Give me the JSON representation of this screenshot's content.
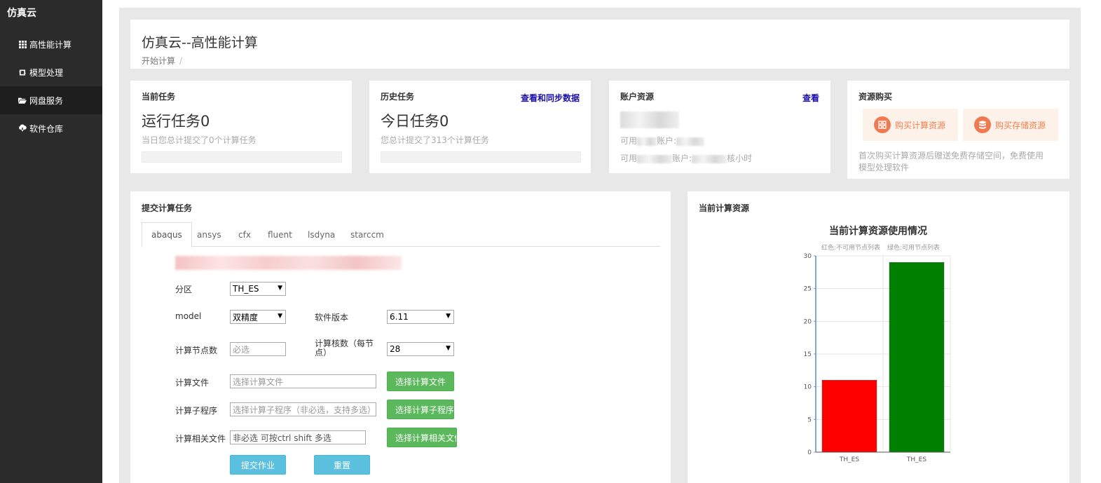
{
  "sidebar": {
    "brand": "仿真云",
    "items": [
      {
        "label": "高性能计算",
        "icon": "grid-icon"
      },
      {
        "label": "模型处理",
        "icon": "retweet-icon"
      },
      {
        "label": "网盘服务",
        "icon": "folder-open-icon"
      },
      {
        "label": "软件仓库",
        "icon": "cloud-download-icon"
      }
    ]
  },
  "header": {
    "title": "仿真云--高性能计算",
    "breadcrumb": "开始计算",
    "breadcrumb_sep": "/"
  },
  "cards": {
    "current": {
      "title": "当前任务",
      "big": "运行任务0",
      "sub": "当日您总计提交了0个计算任务"
    },
    "history": {
      "title": "历史任务",
      "link": "查看和同步数据",
      "big": "今日任务0",
      "sub": "您总计提交了313个计算任务"
    },
    "account": {
      "title": "账户资源",
      "link": "查看",
      "line1_a": "可用",
      "line1_b": "账户:",
      "line2_a": "可用",
      "line2_b": "账户:",
      "line2_c": "核小时"
    },
    "purchase": {
      "title": "资源购买",
      "buy_compute": "购买计算资源",
      "buy_storage": "购买存储资源",
      "note": "首次购买计算资源后赠送免费存储空间，免费使用模型处理软件"
    }
  },
  "submit": {
    "title": "提交计算任务",
    "tabs": [
      "abaqus",
      "ansys",
      "cfx",
      "fluent",
      "lsdyna",
      "starccm"
    ],
    "active_tab": "abaqus",
    "fields": {
      "partition_label": "分区",
      "partition_value": "TH_ES",
      "model_label": "model",
      "model_value": "双精度",
      "version_label": "软件版本",
      "version_value": "6.11",
      "nodes_label": "计算节点数",
      "nodes_placeholder": "必选",
      "cores_label": "计算核数（每节点）",
      "cores_value": "28",
      "file_label": "计算文件",
      "file_placeholder": "选择计算文件",
      "file_button": "选择计算文件",
      "subprog_label": "计算子程序",
      "subprog_placeholder": "选择计算子程序（非必选，支持多选）",
      "subprog_button": "选择计算子程序",
      "related_label": "计算相关文件",
      "related_placeholder": "非必选 可按ctrl shift 多选",
      "related_button": "选择计算相关文件"
    },
    "submit_button": "提交作业",
    "reset_button": "重置"
  },
  "resources": {
    "title": "当前计算资源",
    "colors": {
      "unavailable": "#ff0000",
      "available": "#008000"
    }
  },
  "chart_data": {
    "type": "bar",
    "title": "当前计算资源使用情况",
    "legend": [
      "红色:不可用节点列表",
      "绿色:可用节点列表"
    ],
    "categories": [
      "TH_ES",
      "TH_ES"
    ],
    "values": [
      11,
      29
    ],
    "colors": [
      "#ff0000",
      "#008000"
    ],
    "ylim": [
      0,
      30
    ],
    "yticks": [
      0,
      5,
      10,
      15,
      20,
      25,
      30
    ],
    "xlabel": "",
    "ylabel": ""
  }
}
